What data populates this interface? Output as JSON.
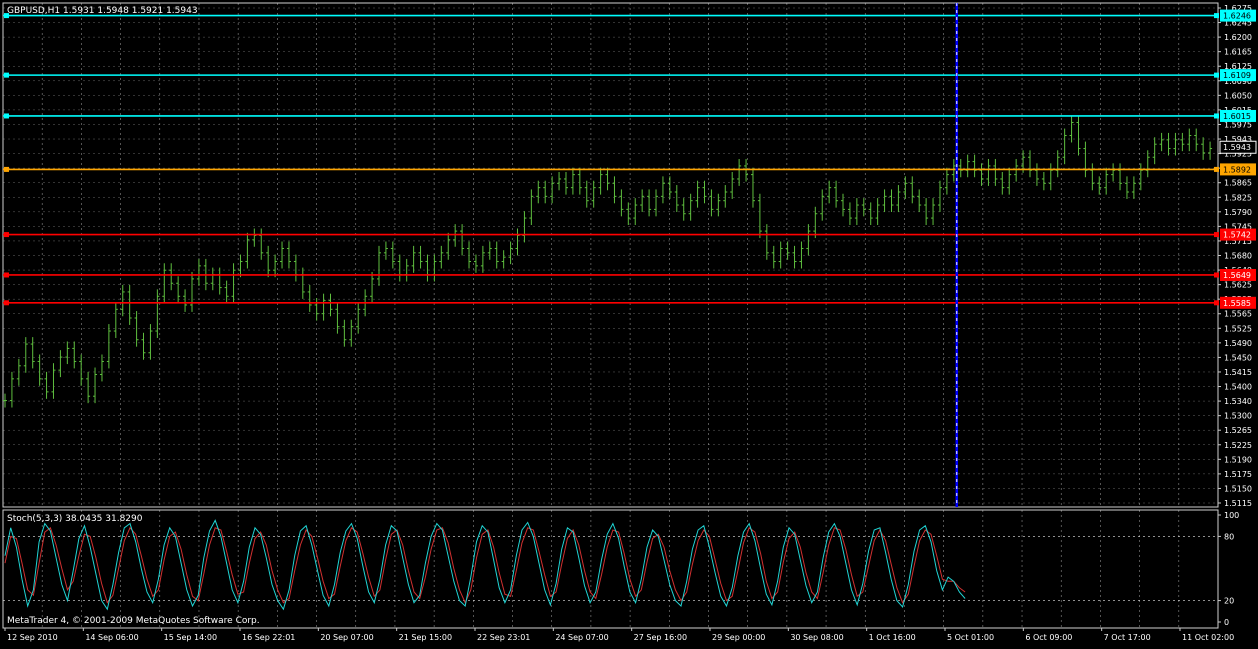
{
  "main_header": "GBPUSD,H1  1.5931 1.5948 1.5921 1.5943",
  "stoch_header": "Stoch(5,3,3) 38.0435 31.8290",
  "footer": "MetaTrader 4, © 2001-2009 MetaQuotes Software Corp.",
  "colors": {
    "background": "#000000",
    "grid": "#ffffff",
    "bars": "#5fbf3f",
    "cyan": "#00ffff",
    "orange": "#ffa500",
    "red": "#ff0000",
    "vline": "#0000ff",
    "stoch_main": "#20d4d4",
    "stoch_signal": "#d03030"
  },
  "chart_data": [
    {
      "type": "line",
      "title": "GBPUSD,H1  1.5931 1.5948 1.5921 1.5943",
      "ylim": [
        1.5115,
        1.6275
      ],
      "y_ticks": [
        "1.6275",
        "1.6245",
        "1.6200",
        "1.6165",
        "1.6125",
        "1.6090",
        "1.6050",
        "1.6015",
        "1.5975",
        "1.5943",
        "1.5925",
        "1.5892",
        "1.5865",
        "1.5825",
        "1.5790",
        "1.5745",
        "1.5715",
        "1.5680",
        "1.5640",
        "1.5625",
        "1.5595",
        "1.5565",
        "1.5525",
        "1.5490",
        "1.5450",
        "1.5415",
        "1.5400",
        "1.5340",
        "1.5300",
        "1.5265",
        "1.5225",
        "1.5190",
        "1.5175",
        "1.5150",
        "1.5115"
      ],
      "x_labels": [
        "12 Sep 2010",
        "14 Sep 06:00",
        "15 Sep 14:00",
        "16 Sep 22:01",
        "20 Sep 07:00",
        "21 Sep 15:00",
        "22 Sep 23:01",
        "24 Sep 07:00",
        "27 Sep 16:00",
        "29 Sep 00:00",
        "30 Sep 08:00",
        "1 Oct 16:00",
        "5 Oct 01:00",
        "6 Oct 09:00",
        "7 Oct 17:00",
        "11 Oct 02:00"
      ],
      "last_price": 1.5943,
      "horizontal_lines": [
        {
          "value": 1.6246,
          "label": "1.6246",
          "color": "cyan"
        },
        {
          "value": 1.6109,
          "label": "1.6109",
          "color": "cyan"
        },
        {
          "value": 1.6015,
          "label": "1.6015",
          "color": "cyan"
        },
        {
          "value": 1.5892,
          "label": "1.5892",
          "color": "orange"
        },
        {
          "value": 1.5742,
          "label": "1.5742",
          "color": "red"
        },
        {
          "value": 1.5649,
          "label": "1.5649",
          "color": "red"
        },
        {
          "value": 1.5585,
          "label": "1.5585",
          "color": "red"
        }
      ],
      "vertical_line_fraction": 0.785,
      "series": [
        {
          "values": [
            1.536,
            1.541,
            1.544,
            1.549,
            1.545,
            1.541,
            1.538,
            1.543,
            1.546,
            1.548,
            1.545,
            1.541,
            1.537,
            1.542,
            1.545,
            1.552,
            1.557,
            1.561,
            1.555,
            1.55,
            1.547,
            1.552,
            1.56,
            1.566,
            1.563,
            1.56,
            1.558,
            1.564,
            1.567,
            1.563,
            1.565,
            1.562,
            1.56,
            1.566,
            1.568,
            1.573,
            1.574,
            1.57,
            1.566,
            1.568,
            1.571,
            1.568,
            1.565,
            1.561,
            1.558,
            1.556,
            1.559,
            1.557,
            1.553,
            1.55,
            1.553,
            1.557,
            1.56,
            1.564,
            1.57,
            1.571,
            1.568,
            1.565,
            1.567,
            1.57,
            1.568,
            1.565,
            1.568,
            1.57,
            1.573,
            1.575,
            1.571,
            1.568,
            1.567,
            1.57,
            1.571,
            1.568,
            1.569,
            1.571,
            1.574,
            1.578,
            1.583,
            1.585,
            1.583,
            1.586,
            1.587,
            1.585,
            1.588,
            1.585,
            1.582,
            1.585,
            1.588,
            1.586,
            1.583,
            1.58,
            1.578,
            1.581,
            1.583,
            1.58,
            1.583,
            1.586,
            1.584,
            1.581,
            1.579,
            1.582,
            1.585,
            1.583,
            1.58,
            1.582,
            1.584,
            1.587,
            1.59,
            1.588,
            1.582,
            1.575,
            1.57,
            1.568,
            1.571,
            1.57,
            1.568,
            1.571,
            1.575,
            1.579,
            1.583,
            1.585,
            1.582,
            1.58,
            1.578,
            1.581,
            1.58,
            1.578,
            1.581,
            1.583,
            1.581,
            1.584,
            1.586,
            1.583,
            1.581,
            1.578,
            1.581,
            1.585,
            1.588,
            1.59,
            1.589,
            1.591,
            1.589,
            1.587,
            1.59,
            1.587,
            1.585,
            1.588,
            1.59,
            1.592,
            1.589,
            1.587,
            1.586,
            1.589,
            1.592,
            1.597,
            1.6,
            1.594,
            1.589,
            1.586,
            1.585,
            1.588,
            1.589,
            1.586,
            1.584,
            1.586,
            1.589,
            1.592,
            1.595,
            1.596,
            1.594,
            1.596,
            1.595,
            1.597,
            1.595,
            1.593,
            1.594
          ]
        }
      ]
    },
    {
      "type": "line",
      "title": "Stoch(5,3,3) 38.0435 31.8290",
      "ylim": [
        0,
        100
      ],
      "y_ticks": [
        "100",
        "80",
        "20",
        "0"
      ],
      "levels": [
        80,
        20
      ],
      "series": [
        {
          "values": [
            62,
            88,
            70,
            40,
            15,
            30,
            75,
            92,
            85,
            60,
            35,
            20,
            48,
            78,
            90,
            70,
            45,
            20,
            12,
            35,
            65,
            88,
            92,
            75,
            50,
            28,
            18,
            40,
            72,
            88,
            80,
            55,
            30,
            15,
            25,
            60,
            85,
            95,
            80,
            55,
            30,
            18,
            38,
            70,
            88,
            82,
            60,
            35,
            20,
            12,
            30,
            62,
            85,
            90,
            72,
            48,
            25,
            15,
            35,
            65,
            85,
            92,
            78,
            52,
            28,
            18,
            40,
            72,
            90,
            85,
            60,
            35,
            18,
            25,
            55,
            80,
            92,
            86,
            62,
            38,
            20,
            15,
            42,
            75,
            90,
            84,
            58,
            32,
            18,
            30,
            62,
            86,
            93,
            80,
            55,
            30,
            16,
            36,
            68,
            88,
            84,
            60,
            34,
            18,
            28,
            58,
            82,
            92,
            78,
            52,
            28,
            18,
            40,
            70,
            86,
            80,
            58,
            35,
            20,
            15,
            38,
            68,
            86,
            90,
            70,
            46,
            24,
            15,
            32,
            62,
            84,
            92,
            76,
            50,
            26,
            16,
            38,
            70,
            88,
            82,
            58,
            34,
            18,
            28,
            60,
            84,
            92,
            80,
            55,
            30,
            16,
            36,
            66,
            86,
            88,
            65,
            40,
            20,
            14,
            35,
            66,
            86,
            90,
            75,
            48,
            30,
            42,
            38,
            28,
            22
          ]
        },
        {
          "values": [
            55,
            80,
            78,
            55,
            30,
            25,
            55,
            84,
            88,
            72,
            50,
            30,
            38,
            62,
            82,
            80,
            60,
            36,
            18,
            25,
            50,
            76,
            88,
            82,
            62,
            40,
            24,
            30,
            58,
            80,
            84,
            68,
            44,
            24,
            20,
            45,
            72,
            88,
            86,
            66,
            44,
            26,
            28,
            55,
            78,
            84,
            72,
            48,
            30,
            18,
            22,
            48,
            72,
            86,
            80,
            60,
            38,
            22,
            26,
            52,
            76,
            88,
            84,
            64,
            42,
            24,
            30,
            58,
            82,
            86,
            72,
            48,
            28,
            22,
            42,
            68,
            86,
            88,
            74,
            50,
            30,
            18,
            30,
            60,
            82,
            86,
            70,
            46,
            26,
            24,
            48,
            74,
            88,
            86,
            66,
            44,
            24,
            28,
            54,
            78,
            86,
            72,
            48,
            28,
            22,
            44,
            70,
            86,
            84,
            64,
            40,
            24,
            30,
            56,
            78,
            82,
            70,
            48,
            30,
            20,
            28,
            54,
            76,
            86,
            80,
            58,
            36,
            20,
            24,
            48,
            74,
            88,
            84,
            64,
            38,
            22,
            28,
            56,
            78,
            84,
            70,
            46,
            28,
            22,
            46,
            72,
            88,
            86,
            68,
            44,
            24,
            28,
            52,
            76,
            86,
            76,
            54,
            32,
            18,
            26,
            52,
            76,
            86,
            82,
            62,
            40,
            38,
            38,
            32,
            28
          ]
        }
      ]
    }
  ]
}
